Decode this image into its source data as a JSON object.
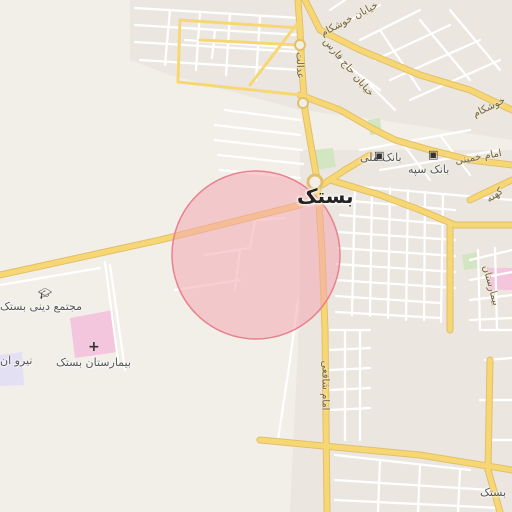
{
  "map": {
    "city_label": "بستک",
    "place_labels": {
      "bank_melli": "بانک ملی",
      "bank_sepah": "بانک سپه",
      "religious_complex": "مجتمع دینی بستک",
      "hospital": "بیمارستان بستک",
      "niru": "نیرو ان",
      "bastak_sw": "بستک"
    },
    "street_labels": {
      "khoshkam_1": "خیابان خوشکام",
      "khoshkam_2": "خوشکام",
      "haj_fars": "خیابان حاج فارس",
      "edalat": "عدالت",
      "imam_khomeini": "امام خمینی",
      "imam_shafei": "امام شافعی",
      "kohneh": "کهنه",
      "bimarestan": "بیمارستان"
    },
    "colors": {
      "background": "#f2efe9",
      "primary_road": "#f7d774",
      "road_casing": "#e2bf6a",
      "minor_road": "#ffffff",
      "circle_fill": "#f4a8b0",
      "circle_stroke": "#e8828e",
      "hospital_area": "#f3c6de",
      "park": "#d2e6c3"
    },
    "icons": {
      "bank": "bank-icon",
      "school": "graduation-cap-icon",
      "hospital": "hospital-cross-icon"
    }
  }
}
